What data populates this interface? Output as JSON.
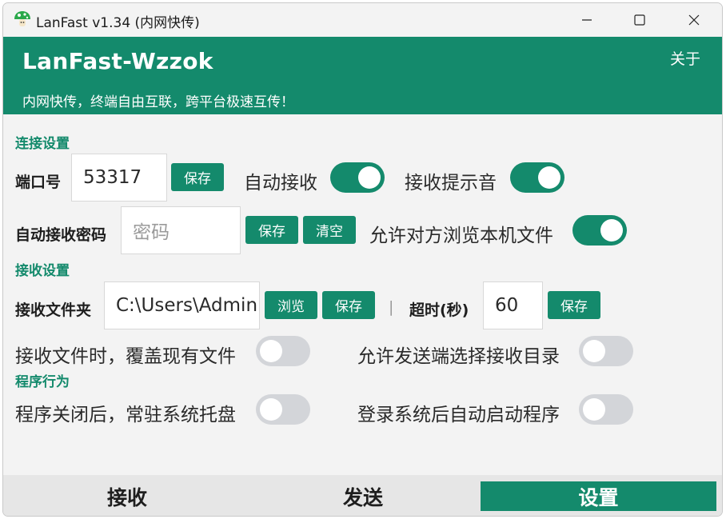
{
  "window": {
    "title": "LanFast v1.34 (内网快传)",
    "icon": "mushroom-icon",
    "controls": [
      "minimize-icon",
      "maximize-icon",
      "close-icon"
    ]
  },
  "header": {
    "brand": "LanFast-Wzzok",
    "about": "关于",
    "tagline": "内网快传，终端自由互联，跨平台极速互传！"
  },
  "colors": {
    "accent": "#148a6c",
    "toggle_off": "#d3d5d9",
    "background": "#f3f3f3"
  },
  "connection": {
    "section_title": "连接设置",
    "port_label": "端口号",
    "port_value": "53317",
    "port_save": "保存",
    "auto_receive_label": "自动接收",
    "auto_receive_on": true,
    "receive_sound_label": "接收提示音",
    "receive_sound_on": true,
    "password_label": "自动接收密码",
    "password_placeholder": "密码",
    "password_save": "保存",
    "password_clear": "清空",
    "allow_browse_label": "允许对方浏览本机文件",
    "allow_browse_on": true
  },
  "receive": {
    "section_title": "接收设置",
    "folder_label": "接收文件夹",
    "folder_value": "C:\\Users\\Administrator\\Downloads",
    "browse_button": "浏览",
    "folder_save": "保存",
    "separator": "|",
    "timeout_label": "超时(秒)",
    "timeout_value": "60",
    "timeout_save": "保存",
    "overwrite_label": "接收文件时，覆盖现有文件",
    "overwrite_on": false,
    "sender_dir_label": "允许发送端选择接收目录",
    "sender_dir_on": false
  },
  "behavior": {
    "section_title": "程序行为",
    "tray_label": "程序关闭后，常驻系统托盘",
    "tray_on": false,
    "autostart_label": "登录系统后自动启动程序",
    "autostart_on": false
  },
  "nav": {
    "tabs": [
      {
        "label": "接收",
        "active": false
      },
      {
        "label": "发送",
        "active": false
      },
      {
        "label": "设置",
        "active": true
      }
    ]
  }
}
